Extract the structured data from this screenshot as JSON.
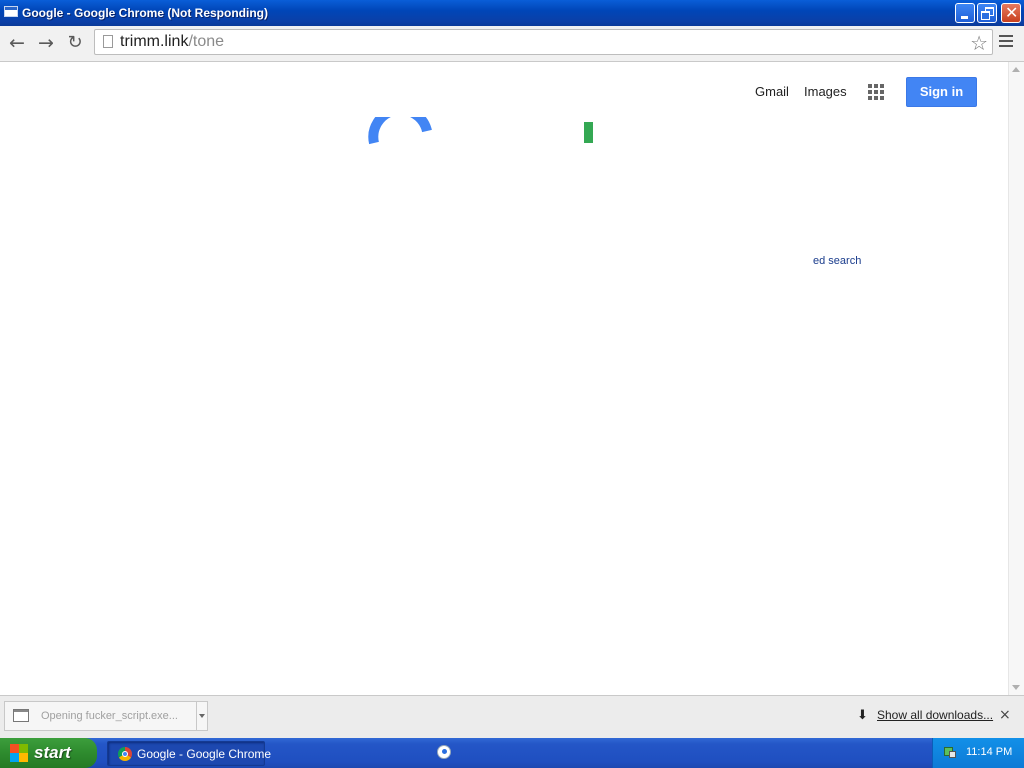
{
  "window": {
    "title": "Google - Google Chrome (Not Responding)",
    "close_glyph": "✕"
  },
  "toolbar": {
    "back_glyph": "←",
    "forward_glyph": "→",
    "reload_glyph": "↻",
    "url_host": "trimm.link",
    "url_path": "/tone",
    "bookmark_glyph": "☆"
  },
  "google": {
    "gmail": "Gmail",
    "images": "Images",
    "sign_in": "Sign in",
    "advanced_search_fragment": "ed search",
    "colors": {
      "blue": "#4285f4",
      "green": "#34a853"
    }
  },
  "downloads": {
    "item_label": "Opening fucker_script.exe...",
    "show_all": "Show all downloads...",
    "close_glyph": "×",
    "download_glyph": "⬇"
  },
  "taskbar": {
    "start": "start",
    "task_label": "Google - Google Chrome",
    "clock": "11:14 PM"
  }
}
